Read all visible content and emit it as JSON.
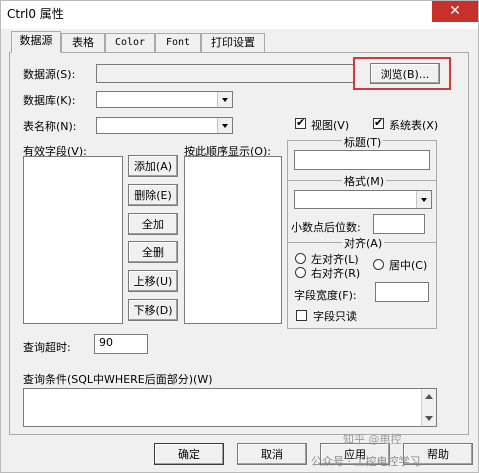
{
  "window": {
    "title": "Ctrl0 属性",
    "close": "✕"
  },
  "tabs": [
    "数据源",
    "表格",
    "Color",
    "Font",
    "打印设置"
  ],
  "datasource": {
    "label": "数据源(S):",
    "value": "",
    "browse_button": "浏览(B)..."
  },
  "database": {
    "label": "数据库(K):",
    "value": ""
  },
  "table_name": {
    "label": "表名称(N):",
    "value": ""
  },
  "checkboxes": {
    "view": {
      "label": "视图(V)",
      "checked": true
    },
    "system_table": {
      "label": "系统表(X)",
      "checked": true
    }
  },
  "valid_fields": {
    "label": "有效字段(V):"
  },
  "display_order": {
    "label": "按此顺序显示(O):"
  },
  "buttons": {
    "add": "添加(A)",
    "delete": "删除(E)",
    "add_all": "全加",
    "delete_all": "全删",
    "move_up": "上移(U)",
    "move_down": "下移(D)"
  },
  "format_panel": {
    "title_label": "标题(T)",
    "title_value": "",
    "format_label": "格式(M)",
    "format_value": "",
    "decimal_label": "小数点后位数:",
    "decimal_value": "",
    "align_label": "对齐(A)",
    "align_left": "左对齐(L)",
    "align_right": "右对齐(R)",
    "align_center": "居中(C)",
    "width_label": "字段宽度(F):",
    "width_value": "",
    "readonly_label": "字段只读"
  },
  "query_timeout": {
    "label": "查询超时:",
    "value": "90"
  },
  "query_condition": {
    "label": "查询条件(SQL中WHERE后面部分)(W)",
    "value": ""
  },
  "footer": {
    "ok": "确定",
    "cancel": "取消",
    "apply": "应用",
    "help": "帮助"
  },
  "watermark": [
    "知乎 @电控",
    "公众号 · 工控电控学习"
  ]
}
